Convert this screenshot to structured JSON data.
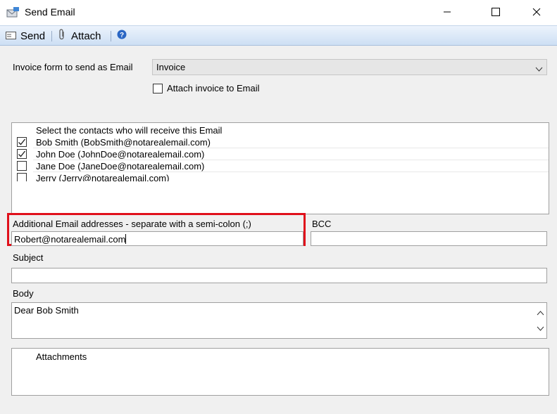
{
  "window": {
    "title": "Send Email",
    "icon": "email-send-icon",
    "controls": [
      "minimize-icon",
      "maximize-icon",
      "close-icon"
    ]
  },
  "toolbar": {
    "send_label": "Send",
    "attach_label": "Attach",
    "help_icon": "help-icon"
  },
  "invoice": {
    "label": "Invoice form to send as Email",
    "selected": "Invoice",
    "attach_label": "Attach invoice to Email",
    "attach_checked": false
  },
  "contacts": {
    "header": "Select the contacts who will receive this Email",
    "items": [
      {
        "label": "Bob Smith (BobSmith@notarealemail.com)",
        "checked": true
      },
      {
        "label": "John Doe (JohnDoe@notarealemail.com)",
        "checked": true
      },
      {
        "label": "Jane Doe (JaneDoe@notarealemail.com)",
        "checked": false
      },
      {
        "label": "Jerry (Jerry@notarealemail.com)",
        "checked": false
      }
    ]
  },
  "additional": {
    "label": "Additional Email addresses - separate with a semi-colon (;)",
    "value": "Robert@notarealemail.com"
  },
  "bcc": {
    "label": "BCC",
    "value": ""
  },
  "subject": {
    "label": "Subject",
    "value": ""
  },
  "body": {
    "label": "Body",
    "value": "Dear Bob Smith"
  },
  "attachments": {
    "header": "Attachments"
  },
  "colors": {
    "highlight": "#e0101b",
    "toolbar": "#cddff4"
  }
}
